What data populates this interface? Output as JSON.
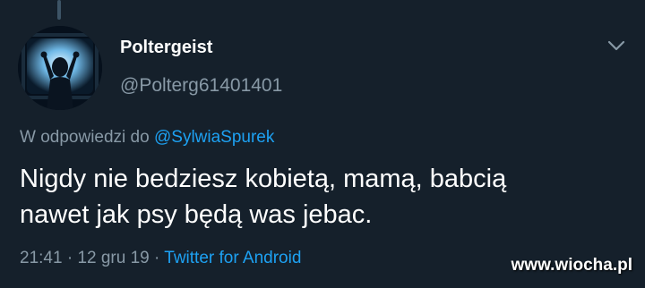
{
  "author": {
    "name": "Poltergeist",
    "handle": "@Polterg61401401"
  },
  "reply": {
    "prefix": "W odpowiedzi do",
    "mention": "@SylwiaSpurek"
  },
  "tweet": {
    "text_line1": "Nigdy nie bedziesz kobietą, mamą, babcią",
    "text_line2": "nawet jak psy będą was jebac."
  },
  "meta": {
    "time": "21:41",
    "separator1": "·",
    "date": "12 gru 19",
    "separator2": "·",
    "source": "Twitter for Android"
  },
  "watermark": "www.wiocha.pl",
  "icons": {
    "menu": "chevron-down-icon"
  },
  "colors": {
    "background": "#15202b",
    "secondary_text": "#8899a6",
    "link": "#1da1f2"
  }
}
